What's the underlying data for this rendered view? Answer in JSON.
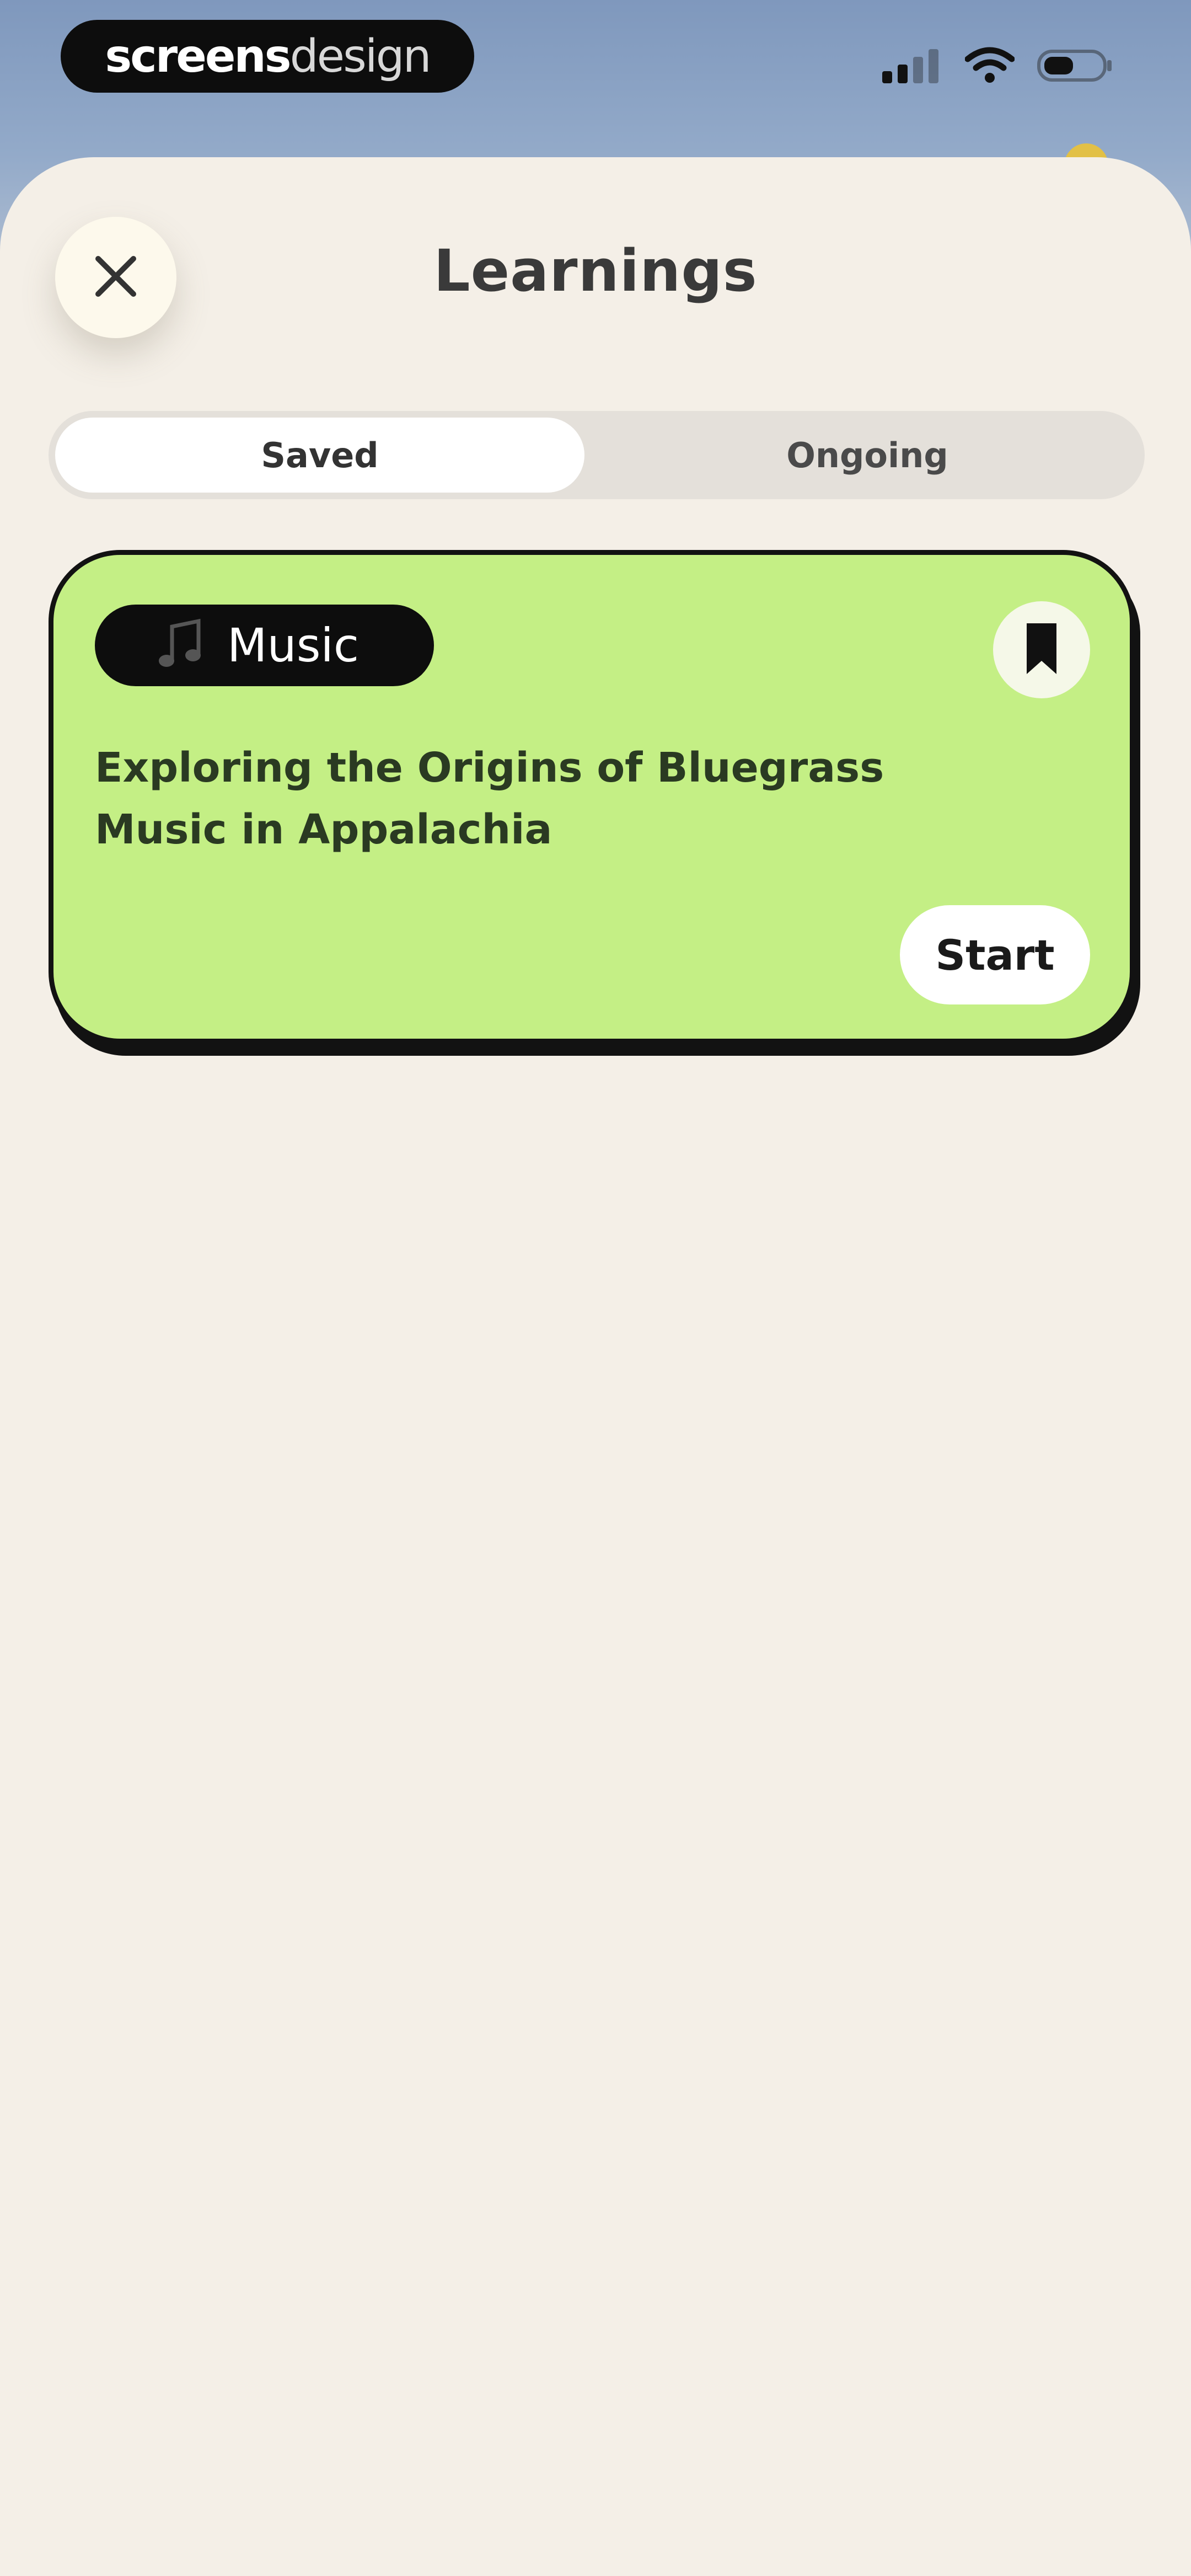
{
  "status_bar": {
    "brand_strong": "screens",
    "brand_light": "design",
    "icons": [
      "signal-icon",
      "wifi-icon",
      "battery-icon"
    ]
  },
  "header": {
    "title": "Learnings",
    "close_icon": "close-icon"
  },
  "tabs": [
    {
      "label": "Saved",
      "active": true
    },
    {
      "label": "Ongoing",
      "active": false
    }
  ],
  "card": {
    "tag_icon": "music-note-icon",
    "tag_label": "Music",
    "title": "Exploring the Origins of Bluegrass Music in Appalachia",
    "bookmark_icon": "bookmark-icon",
    "start_label": "Start"
  },
  "colors": {
    "card_background": "#c4ef85",
    "sheet_background": "#f4efe7",
    "accent_dark": "#0d0d0d"
  }
}
